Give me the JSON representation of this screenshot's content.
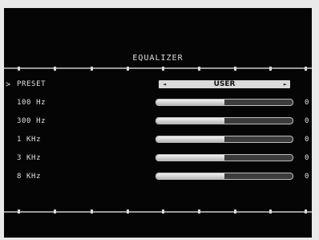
{
  "title": "EQUALIZER",
  "menu": {
    "cursor": ">",
    "preset": {
      "label": "PRESET",
      "value": "USER",
      "left_arrow": "◄",
      "right_arrow": "►"
    },
    "bands": [
      {
        "label": "100 Hz",
        "value": "0",
        "level_percent": 50
      },
      {
        "label": "300 Hz",
        "value": "0",
        "level_percent": 50
      },
      {
        "label": "1 KHz",
        "value": "0",
        "level_percent": 50
      },
      {
        "label": "3 KHz",
        "value": "0",
        "level_percent": 50
      },
      {
        "label": "8 KHz",
        "value": "0",
        "level_percent": 50
      }
    ]
  },
  "colors": {
    "background": "#050505",
    "text": "#e0e0e0",
    "slider_fill": "#e0e0e0",
    "slider_track": "#3c3c3c"
  }
}
